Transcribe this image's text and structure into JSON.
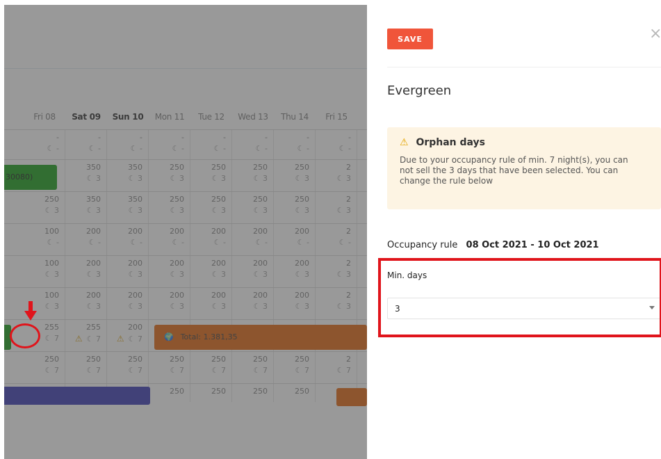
{
  "calendar": {
    "days": [
      {
        "label": "Fri 08",
        "weekend": false
      },
      {
        "label": "Sat 09",
        "weekend": true
      },
      {
        "label": "Sun 10",
        "weekend": true
      },
      {
        "label": "Mon 11",
        "weekend": false
      },
      {
        "label": "Tue 12",
        "weekend": false
      },
      {
        "label": "Wed 13",
        "weekend": false
      },
      {
        "label": "Thu 14",
        "weekend": false
      },
      {
        "label": "Fri 15",
        "weekend": false
      }
    ],
    "rows": [
      {
        "values": [
          "-",
          "-",
          "-",
          "-",
          "-",
          "-",
          "-",
          "-"
        ],
        "mins": [
          "-",
          "-",
          "-",
          "-",
          "-",
          "-",
          "-",
          "-"
        ]
      },
      {
        "values": [
          "",
          "350",
          "350",
          "250",
          "250",
          "250",
          "250",
          "2"
        ],
        "mins": [
          "",
          "3",
          "3",
          "3",
          "3",
          "3",
          "3",
          "3"
        ]
      },
      {
        "values": [
          "250",
          "350",
          "350",
          "250",
          "250",
          "250",
          "250",
          "2"
        ],
        "mins": [
          "3",
          "3",
          "3",
          "3",
          "3",
          "3",
          "3",
          "3"
        ]
      },
      {
        "values": [
          "100",
          "200",
          "200",
          "200",
          "200",
          "200",
          "200",
          "2"
        ],
        "mins": [
          "-",
          "-",
          "-",
          "-",
          "-",
          "-",
          "-",
          "-"
        ]
      },
      {
        "values": [
          "100",
          "200",
          "200",
          "200",
          "200",
          "200",
          "200",
          "2"
        ],
        "mins": [
          "3",
          "3",
          "3",
          "3",
          "3",
          "3",
          "3",
          "3"
        ]
      },
      {
        "values": [
          "100",
          "200",
          "200",
          "200",
          "200",
          "200",
          "200",
          "2"
        ],
        "mins": [
          "3",
          "3",
          "3",
          "3",
          "3",
          "3",
          "3",
          "3"
        ]
      },
      {
        "values": [
          "255",
          "255",
          "200",
          "",
          "",
          "",
          "",
          ""
        ],
        "mins": [
          "7",
          "7",
          "7",
          "",
          "",
          "",
          "",
          ""
        ]
      },
      {
        "values": [
          "250",
          "250",
          "250",
          "250",
          "250",
          "250",
          "250",
          "2"
        ],
        "mins": [
          "7",
          "7",
          "7",
          "7",
          "7",
          "7",
          "7",
          "7"
        ]
      },
      {
        "values": [
          "",
          "",
          "",
          "250",
          "250",
          "250",
          "250",
          ""
        ],
        "mins": [
          "",
          "",
          "",
          "",
          "",
          "",
          "",
          ""
        ]
      }
    ],
    "green_bar_text": "30080)",
    "orange_bar_text": "Total: 1.381,35",
    "colors": {
      "green": "#0a9a0a",
      "orange": "#e25d00",
      "blue": "#2f2fb0"
    }
  },
  "panel": {
    "save_label": "SAVE",
    "title": "Evergreen",
    "alert": {
      "heading": "Orphan days",
      "icon": "warning-icon",
      "text": "Due to your occupancy rule of min. 7 night(s), you can not sell the 3 days that have been selected. You can change the rule below"
    },
    "occupancy_label": "Occupancy rule",
    "occupancy_dates": "08 Oct 2021 - 10 Oct 2021",
    "min_days_label": "Min. days",
    "min_days_value": "3"
  }
}
